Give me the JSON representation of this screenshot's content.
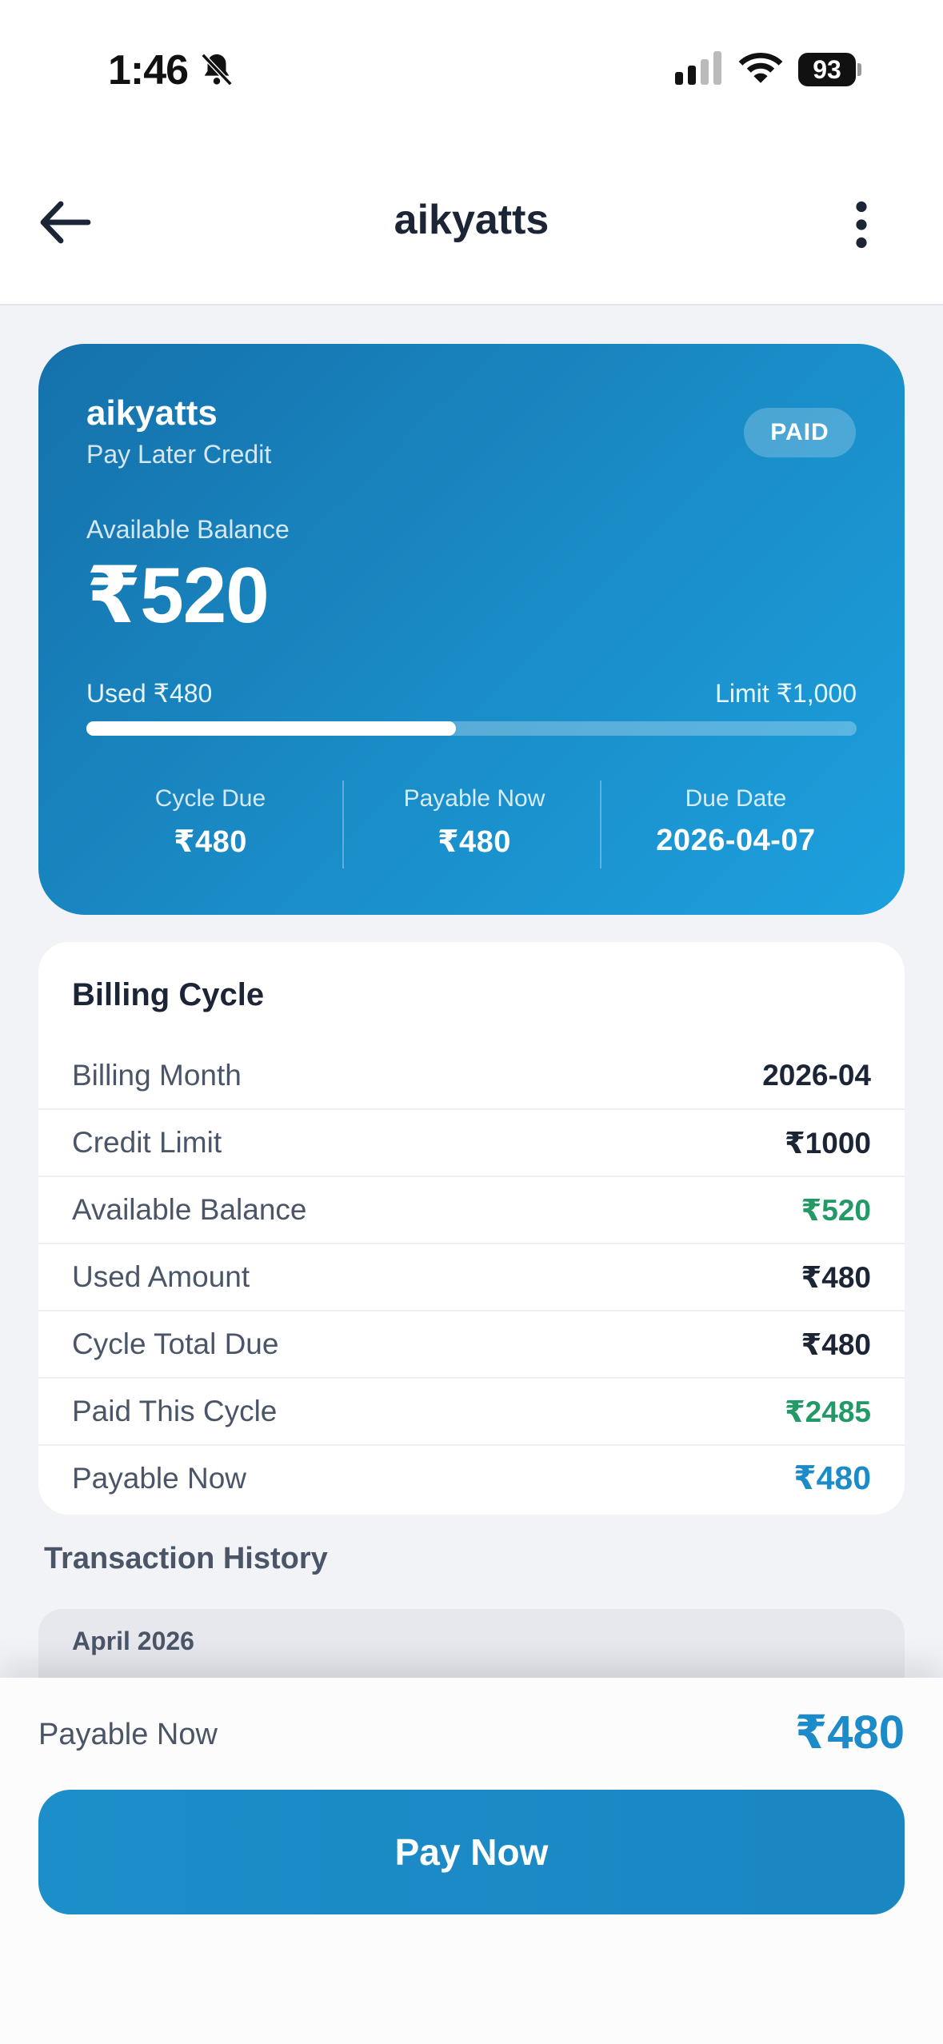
{
  "status_bar": {
    "time": "1:46",
    "battery": "93",
    "icons": [
      "bell-slash-icon",
      "signal-icon",
      "wifi-icon",
      "battery-icon"
    ]
  },
  "nav": {
    "title": "aikyatts",
    "back_icon": "arrow-left-icon",
    "menu_icon": "more-vertical-icon"
  },
  "hero": {
    "name": "aikyatts",
    "subtitle": "Pay Later Credit",
    "badge": "PAID",
    "available_label": "Available Balance",
    "available_value": "₹520",
    "used_label": "Used ₹480",
    "limit_label": "Limit ₹1,000",
    "usage_fraction": 0.48,
    "stats": [
      {
        "label": "Cycle Due",
        "value": "₹480"
      },
      {
        "label": "Payable Now",
        "value": "₹480"
      },
      {
        "label": "Due Date",
        "value": "2026-04-07"
      }
    ],
    "gradient": [
      "#1571ab",
      "#1ca0de"
    ]
  },
  "billing": {
    "title": "Billing Cycle",
    "rows": [
      {
        "label": "Billing Month",
        "value": "2026-04",
        "color": "default"
      },
      {
        "label": "Credit Limit",
        "value": "₹1000",
        "color": "default"
      },
      {
        "label": "Available Balance",
        "value": "₹520",
        "color": "green"
      },
      {
        "label": "Used Amount",
        "value": "₹480",
        "color": "default"
      },
      {
        "label": "Cycle Total Due",
        "value": "₹480",
        "color": "default"
      },
      {
        "label": "Paid This Cycle",
        "value": "₹2485",
        "color": "green"
      },
      {
        "label": "Payable Now",
        "value": "₹480",
        "color": "blue"
      }
    ]
  },
  "transactions": {
    "title": "Transaction History",
    "month": "April 2026"
  },
  "footer": {
    "payable_label": "Payable Now",
    "payable_amount": "₹480",
    "pay_button": "Pay Now"
  },
  "colors": {
    "accent": "#1c8bc8",
    "positive": "#229966",
    "text": "#1c2536",
    "muted": "#4a5568",
    "background": "#f2f3f7"
  }
}
